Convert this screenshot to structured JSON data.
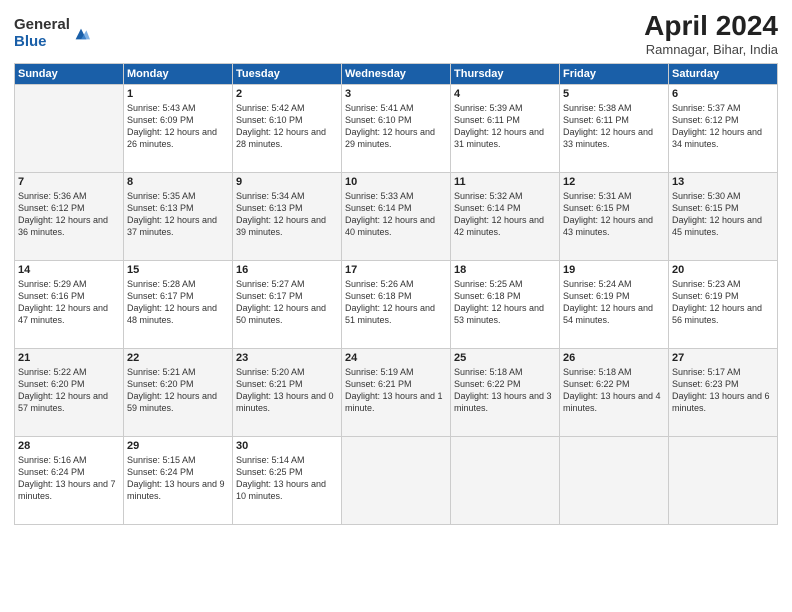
{
  "header": {
    "logo_general": "General",
    "logo_blue": "Blue",
    "month": "April 2024",
    "location": "Ramnagar, Bihar, India"
  },
  "weekdays": [
    "Sunday",
    "Monday",
    "Tuesday",
    "Wednesday",
    "Thursday",
    "Friday",
    "Saturday"
  ],
  "weeks": [
    [
      {
        "day": "",
        "sunrise": "",
        "sunset": "",
        "daylight": ""
      },
      {
        "day": "1",
        "sunrise": "Sunrise: 5:43 AM",
        "sunset": "Sunset: 6:09 PM",
        "daylight": "Daylight: 12 hours and 26 minutes."
      },
      {
        "day": "2",
        "sunrise": "Sunrise: 5:42 AM",
        "sunset": "Sunset: 6:10 PM",
        "daylight": "Daylight: 12 hours and 28 minutes."
      },
      {
        "day": "3",
        "sunrise": "Sunrise: 5:41 AM",
        "sunset": "Sunset: 6:10 PM",
        "daylight": "Daylight: 12 hours and 29 minutes."
      },
      {
        "day": "4",
        "sunrise": "Sunrise: 5:39 AM",
        "sunset": "Sunset: 6:11 PM",
        "daylight": "Daylight: 12 hours and 31 minutes."
      },
      {
        "day": "5",
        "sunrise": "Sunrise: 5:38 AM",
        "sunset": "Sunset: 6:11 PM",
        "daylight": "Daylight: 12 hours and 33 minutes."
      },
      {
        "day": "6",
        "sunrise": "Sunrise: 5:37 AM",
        "sunset": "Sunset: 6:12 PM",
        "daylight": "Daylight: 12 hours and 34 minutes."
      }
    ],
    [
      {
        "day": "7",
        "sunrise": "Sunrise: 5:36 AM",
        "sunset": "Sunset: 6:12 PM",
        "daylight": "Daylight: 12 hours and 36 minutes."
      },
      {
        "day": "8",
        "sunrise": "Sunrise: 5:35 AM",
        "sunset": "Sunset: 6:13 PM",
        "daylight": "Daylight: 12 hours and 37 minutes."
      },
      {
        "day": "9",
        "sunrise": "Sunrise: 5:34 AM",
        "sunset": "Sunset: 6:13 PM",
        "daylight": "Daylight: 12 hours and 39 minutes."
      },
      {
        "day": "10",
        "sunrise": "Sunrise: 5:33 AM",
        "sunset": "Sunset: 6:14 PM",
        "daylight": "Daylight: 12 hours and 40 minutes."
      },
      {
        "day": "11",
        "sunrise": "Sunrise: 5:32 AM",
        "sunset": "Sunset: 6:14 PM",
        "daylight": "Daylight: 12 hours and 42 minutes."
      },
      {
        "day": "12",
        "sunrise": "Sunrise: 5:31 AM",
        "sunset": "Sunset: 6:15 PM",
        "daylight": "Daylight: 12 hours and 43 minutes."
      },
      {
        "day": "13",
        "sunrise": "Sunrise: 5:30 AM",
        "sunset": "Sunset: 6:15 PM",
        "daylight": "Daylight: 12 hours and 45 minutes."
      }
    ],
    [
      {
        "day": "14",
        "sunrise": "Sunrise: 5:29 AM",
        "sunset": "Sunset: 6:16 PM",
        "daylight": "Daylight: 12 hours and 47 minutes."
      },
      {
        "day": "15",
        "sunrise": "Sunrise: 5:28 AM",
        "sunset": "Sunset: 6:17 PM",
        "daylight": "Daylight: 12 hours and 48 minutes."
      },
      {
        "day": "16",
        "sunrise": "Sunrise: 5:27 AM",
        "sunset": "Sunset: 6:17 PM",
        "daylight": "Daylight: 12 hours and 50 minutes."
      },
      {
        "day": "17",
        "sunrise": "Sunrise: 5:26 AM",
        "sunset": "Sunset: 6:18 PM",
        "daylight": "Daylight: 12 hours and 51 minutes."
      },
      {
        "day": "18",
        "sunrise": "Sunrise: 5:25 AM",
        "sunset": "Sunset: 6:18 PM",
        "daylight": "Daylight: 12 hours and 53 minutes."
      },
      {
        "day": "19",
        "sunrise": "Sunrise: 5:24 AM",
        "sunset": "Sunset: 6:19 PM",
        "daylight": "Daylight: 12 hours and 54 minutes."
      },
      {
        "day": "20",
        "sunrise": "Sunrise: 5:23 AM",
        "sunset": "Sunset: 6:19 PM",
        "daylight": "Daylight: 12 hours and 56 minutes."
      }
    ],
    [
      {
        "day": "21",
        "sunrise": "Sunrise: 5:22 AM",
        "sunset": "Sunset: 6:20 PM",
        "daylight": "Daylight: 12 hours and 57 minutes."
      },
      {
        "day": "22",
        "sunrise": "Sunrise: 5:21 AM",
        "sunset": "Sunset: 6:20 PM",
        "daylight": "Daylight: 12 hours and 59 minutes."
      },
      {
        "day": "23",
        "sunrise": "Sunrise: 5:20 AM",
        "sunset": "Sunset: 6:21 PM",
        "daylight": "Daylight: 13 hours and 0 minutes."
      },
      {
        "day": "24",
        "sunrise": "Sunrise: 5:19 AM",
        "sunset": "Sunset: 6:21 PM",
        "daylight": "Daylight: 13 hours and 1 minute."
      },
      {
        "day": "25",
        "sunrise": "Sunrise: 5:18 AM",
        "sunset": "Sunset: 6:22 PM",
        "daylight": "Daylight: 13 hours and 3 minutes."
      },
      {
        "day": "26",
        "sunrise": "Sunrise: 5:18 AM",
        "sunset": "Sunset: 6:22 PM",
        "daylight": "Daylight: 13 hours and 4 minutes."
      },
      {
        "day": "27",
        "sunrise": "Sunrise: 5:17 AM",
        "sunset": "Sunset: 6:23 PM",
        "daylight": "Daylight: 13 hours and 6 minutes."
      }
    ],
    [
      {
        "day": "28",
        "sunrise": "Sunrise: 5:16 AM",
        "sunset": "Sunset: 6:24 PM",
        "daylight": "Daylight: 13 hours and 7 minutes."
      },
      {
        "day": "29",
        "sunrise": "Sunrise: 5:15 AM",
        "sunset": "Sunset: 6:24 PM",
        "daylight": "Daylight: 13 hours and 9 minutes."
      },
      {
        "day": "30",
        "sunrise": "Sunrise: 5:14 AM",
        "sunset": "Sunset: 6:25 PM",
        "daylight": "Daylight: 13 hours and 10 minutes."
      },
      {
        "day": "",
        "sunrise": "",
        "sunset": "",
        "daylight": ""
      },
      {
        "day": "",
        "sunrise": "",
        "sunset": "",
        "daylight": ""
      },
      {
        "day": "",
        "sunrise": "",
        "sunset": "",
        "daylight": ""
      },
      {
        "day": "",
        "sunrise": "",
        "sunset": "",
        "daylight": ""
      }
    ]
  ]
}
